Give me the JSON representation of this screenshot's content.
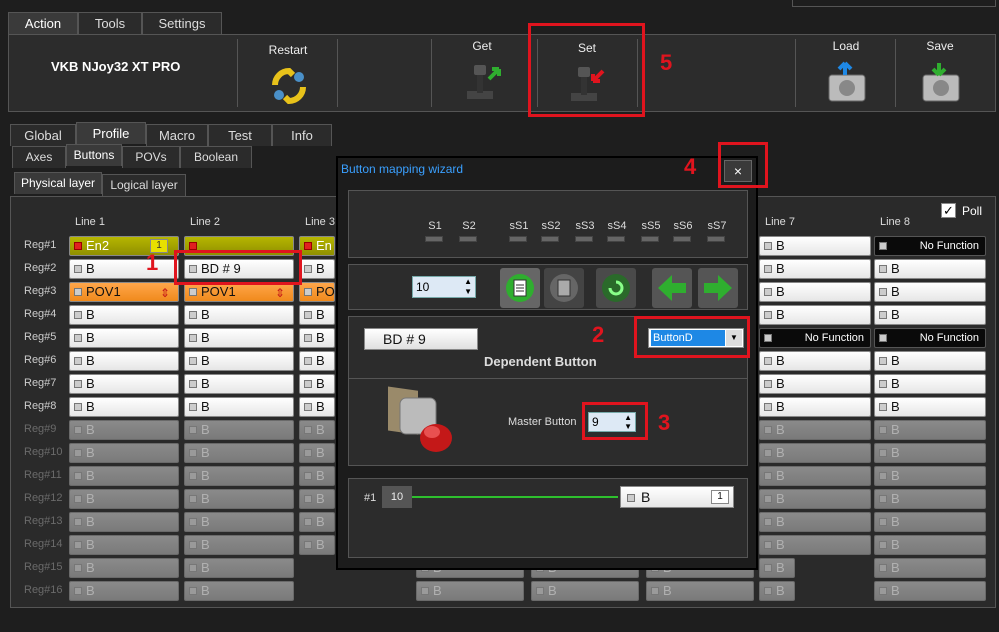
{
  "menu_tabs": [
    "Action",
    "Tools",
    "Settings"
  ],
  "device_name": "VKB NJoy32 XT PRO",
  "toolbar": {
    "restart": "Restart",
    "get": "Get",
    "set": "Set",
    "load": "Load",
    "save": "Save"
  },
  "main_tabs": [
    "Global",
    "Profile",
    "Macro",
    "Test",
    "Info"
  ],
  "sub_tabs": [
    "Axes",
    "Buttons",
    "POVs",
    "Boolean"
  ],
  "layer_tabs": [
    "Physical layer",
    "Logical layer"
  ],
  "poll_label": "Poll",
  "columns": [
    "Line 1",
    "Line 2",
    "Line 3",
    "Line 7",
    "Line 8"
  ],
  "rows": [
    "Reg#1",
    "Reg#2",
    "Reg#3",
    "Reg#4",
    "Reg#5",
    "Reg#6",
    "Reg#7",
    "Reg#8",
    "Reg#9",
    "Reg#10",
    "Reg#11",
    "Reg#12",
    "Reg#13",
    "Reg#14",
    "Reg#15",
    "Reg#16"
  ],
  "cells": {
    "r1c1": "En2",
    "r1c1_badge": "1",
    "r1c3": "En",
    "r2c2": "BD  # 9",
    "r3c1": "POV1",
    "r3c2": "POV1",
    "r3c3": "PO",
    "b": "B",
    "no_function": "No Function"
  },
  "wizard": {
    "title": "Button mapping wizard",
    "close": "×",
    "leds": [
      "S1",
      "S2",
      "sS1",
      "sS2",
      "sS3",
      "sS4",
      "sS5",
      "sS6",
      "sS7"
    ],
    "spin_value": "10",
    "bd_button": "BD  # 9",
    "type_select": "ButtonD",
    "dependent_label": "Dependent Button",
    "master_label": "Master Button",
    "master_value": "9",
    "chain_label": "#1",
    "chain_value": "10",
    "chain_b": "B",
    "chain_b_num": "1"
  },
  "annotations": [
    "1",
    "2",
    "3",
    "4",
    "5"
  ],
  "colors": {
    "accent_red": "#e0141e",
    "green_arrow": "#2fae2f",
    "select_blue": "#1e88e5"
  }
}
